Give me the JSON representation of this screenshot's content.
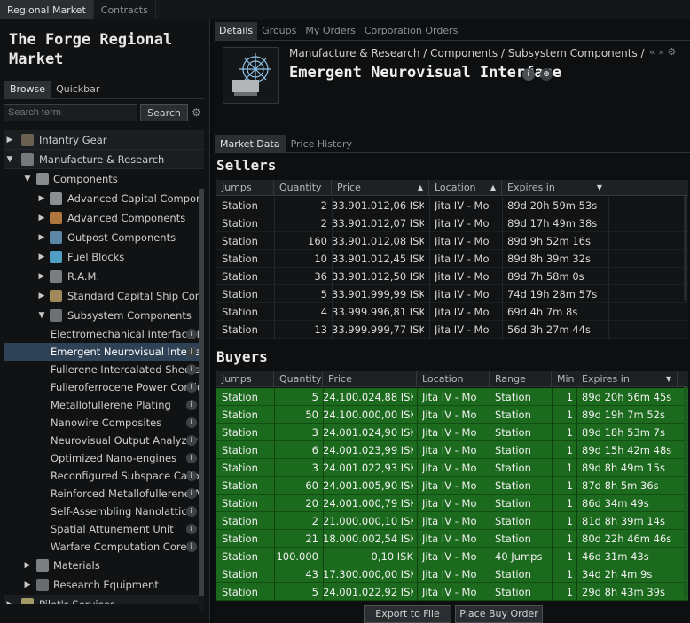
{
  "top_tabs": [
    "Regional Market",
    "Contracts"
  ],
  "market_title": "The Forge Regional Market",
  "left_tabs": [
    "Browse",
    "Quickbar"
  ],
  "search": {
    "placeholder": "Search term",
    "button": "Search"
  },
  "tree": {
    "groups": [
      {
        "label": "Infantry Gear",
        "icon": "infantry-icon"
      },
      {
        "label": "Manufacture & Research",
        "icon": "manufacture-icon"
      }
    ],
    "components_label": "Components",
    "components_children": [
      {
        "label": "Advanced Capital Componen",
        "icon": "advanced-capital-icon"
      },
      {
        "label": "Advanced Components",
        "icon": "advanced-components-icon"
      },
      {
        "label": "Outpost Components",
        "icon": "outpost-icon"
      },
      {
        "label": "Fuel Blocks",
        "icon": "fuel-blocks-icon"
      },
      {
        "label": "R.A.M.",
        "icon": "ram-icon"
      },
      {
        "label": "Standard Capital Ship Comp",
        "icon": "capital-ship-icon"
      }
    ],
    "subsystem_label": "Subsystem Components",
    "subsystem_items": [
      "Electromechanical Interface Nexu",
      "Emergent Neurovisual Interface",
      "Fullerene Intercalated Sheets",
      "Fulleroferrocene Power Conduits",
      "Metallofullerene Plating",
      "Nanowire Composites",
      "Neurovisual Output Analyzer",
      "Optimized Nano-engines",
      "Reconfigured Subspace Calibrat",
      "Reinforced Metallofullerene Allo",
      "Self-Assembling Nanolattice",
      "Spatial Attunement Unit",
      "Warfare Computation Core"
    ],
    "selected_index": 1,
    "after": [
      {
        "label": "Materials",
        "icon": "materials-icon"
      },
      {
        "label": "Research Equipment",
        "icon": "research-equipment-icon"
      }
    ],
    "bottom_groups": [
      {
        "label": "Pilot's Services",
        "icon": "pilots-services-icon"
      }
    ]
  },
  "detail_tabs": [
    "Details",
    "Groups",
    "My Orders",
    "Corporation Orders"
  ],
  "breadcrumb": "Manufacture & Research / Components / Subsystem Components /",
  "item_name": "Emergent Neurovisual Interface",
  "market_tabs": [
    "Market Data",
    "Price History"
  ],
  "sellers": {
    "title": "Sellers",
    "columns": [
      "Jumps",
      "Quantity",
      "Price",
      "Location",
      "Expires in"
    ],
    "rows": [
      [
        "Station",
        "2",
        "33.901.012,06 ISK",
        "Jita IV - Mo",
        "89d 20h 59m 53s"
      ],
      [
        "Station",
        "2",
        "33.901.012,07 ISK",
        "Jita IV - Mo",
        "89d 17h 49m 38s"
      ],
      [
        "Station",
        "160",
        "33.901.012,08 ISK",
        "Jita IV - Mo",
        "89d 9h 52m 16s"
      ],
      [
        "Station",
        "10",
        "33.901.012,45 ISK",
        "Jita IV - Mo",
        "89d 8h 39m 32s"
      ],
      [
        "Station",
        "36",
        "33.901.012,50 ISK",
        "Jita IV - Mo",
        "89d 7h 58m 0s"
      ],
      [
        "Station",
        "5",
        "33.901.999,99 ISK",
        "Jita IV - Mo",
        "74d 19h 28m 57s"
      ],
      [
        "Station",
        "4",
        "33.999.996,81 ISK",
        "Jita IV - Mo",
        "69d 4h 7m 8s"
      ],
      [
        "Station",
        "13",
        "33.999.999,77 ISK",
        "Jita IV - Mo",
        "56d 3h 27m 44s"
      ]
    ]
  },
  "buyers": {
    "title": "Buyers",
    "columns": [
      "Jumps",
      "Quantity",
      "Price",
      "Location",
      "Range",
      "Min",
      "Expires in"
    ],
    "rows": [
      [
        "Station",
        "5",
        "24.100.024,88 ISK",
        "Jita IV - Mo",
        "Station",
        "1",
        "89d 20h 56m 45s"
      ],
      [
        "Station",
        "50",
        "24.100.000,00 ISK",
        "Jita IV - Mo",
        "Station",
        "1",
        "89d 19h 7m 52s"
      ],
      [
        "Station",
        "3",
        "24.001.024,90 ISK",
        "Jita IV - Mo",
        "Station",
        "1",
        "89d 18h 53m 7s"
      ],
      [
        "Station",
        "6",
        "24.001.023,99 ISK",
        "Jita IV - Mo",
        "Station",
        "1",
        "89d 15h 42m 48s"
      ],
      [
        "Station",
        "3",
        "24.001.022,93 ISK",
        "Jita IV - Mo",
        "Station",
        "1",
        "89d 8h 49m 15s"
      ],
      [
        "Station",
        "60",
        "24.001.005,90 ISK",
        "Jita IV - Mo",
        "Station",
        "1",
        "87d 8h 5m 36s"
      ],
      [
        "Station",
        "20",
        "24.001.000,79 ISK",
        "Jita IV - Mo",
        "Station",
        "1",
        "86d 34m 49s"
      ],
      [
        "Station",
        "2",
        "21.000.000,10 ISK",
        "Jita IV - Mo",
        "Station",
        "1",
        "81d 8h 39m 14s"
      ],
      [
        "Station",
        "21",
        "18.000.002,54 ISK",
        "Jita IV - Mo",
        "Station",
        "1",
        "80d 22h 46m 46s"
      ],
      [
        "Station",
        "100.000",
        "0,10 ISK",
        "Jita IV - Mo",
        "40 Jumps",
        "1",
        "46d 31m 43s"
      ],
      [
        "Station",
        "43",
        "17.300.000,00 ISK",
        "Jita IV - Mo",
        "Station",
        "1",
        "34d 2h 4m 9s"
      ],
      [
        "Station",
        "5",
        "24.001.022,92 ISK",
        "Jita IV - Mo",
        "Station",
        "1",
        "29d 8h 43m 39s"
      ]
    ]
  },
  "buttons": {
    "export": "Export to File",
    "place_buy": "Place Buy Order"
  },
  "colors": {
    "buyer_row": "#1c6a1d",
    "selected_row": "#2f4154",
    "panel_bg": "#101213"
  }
}
